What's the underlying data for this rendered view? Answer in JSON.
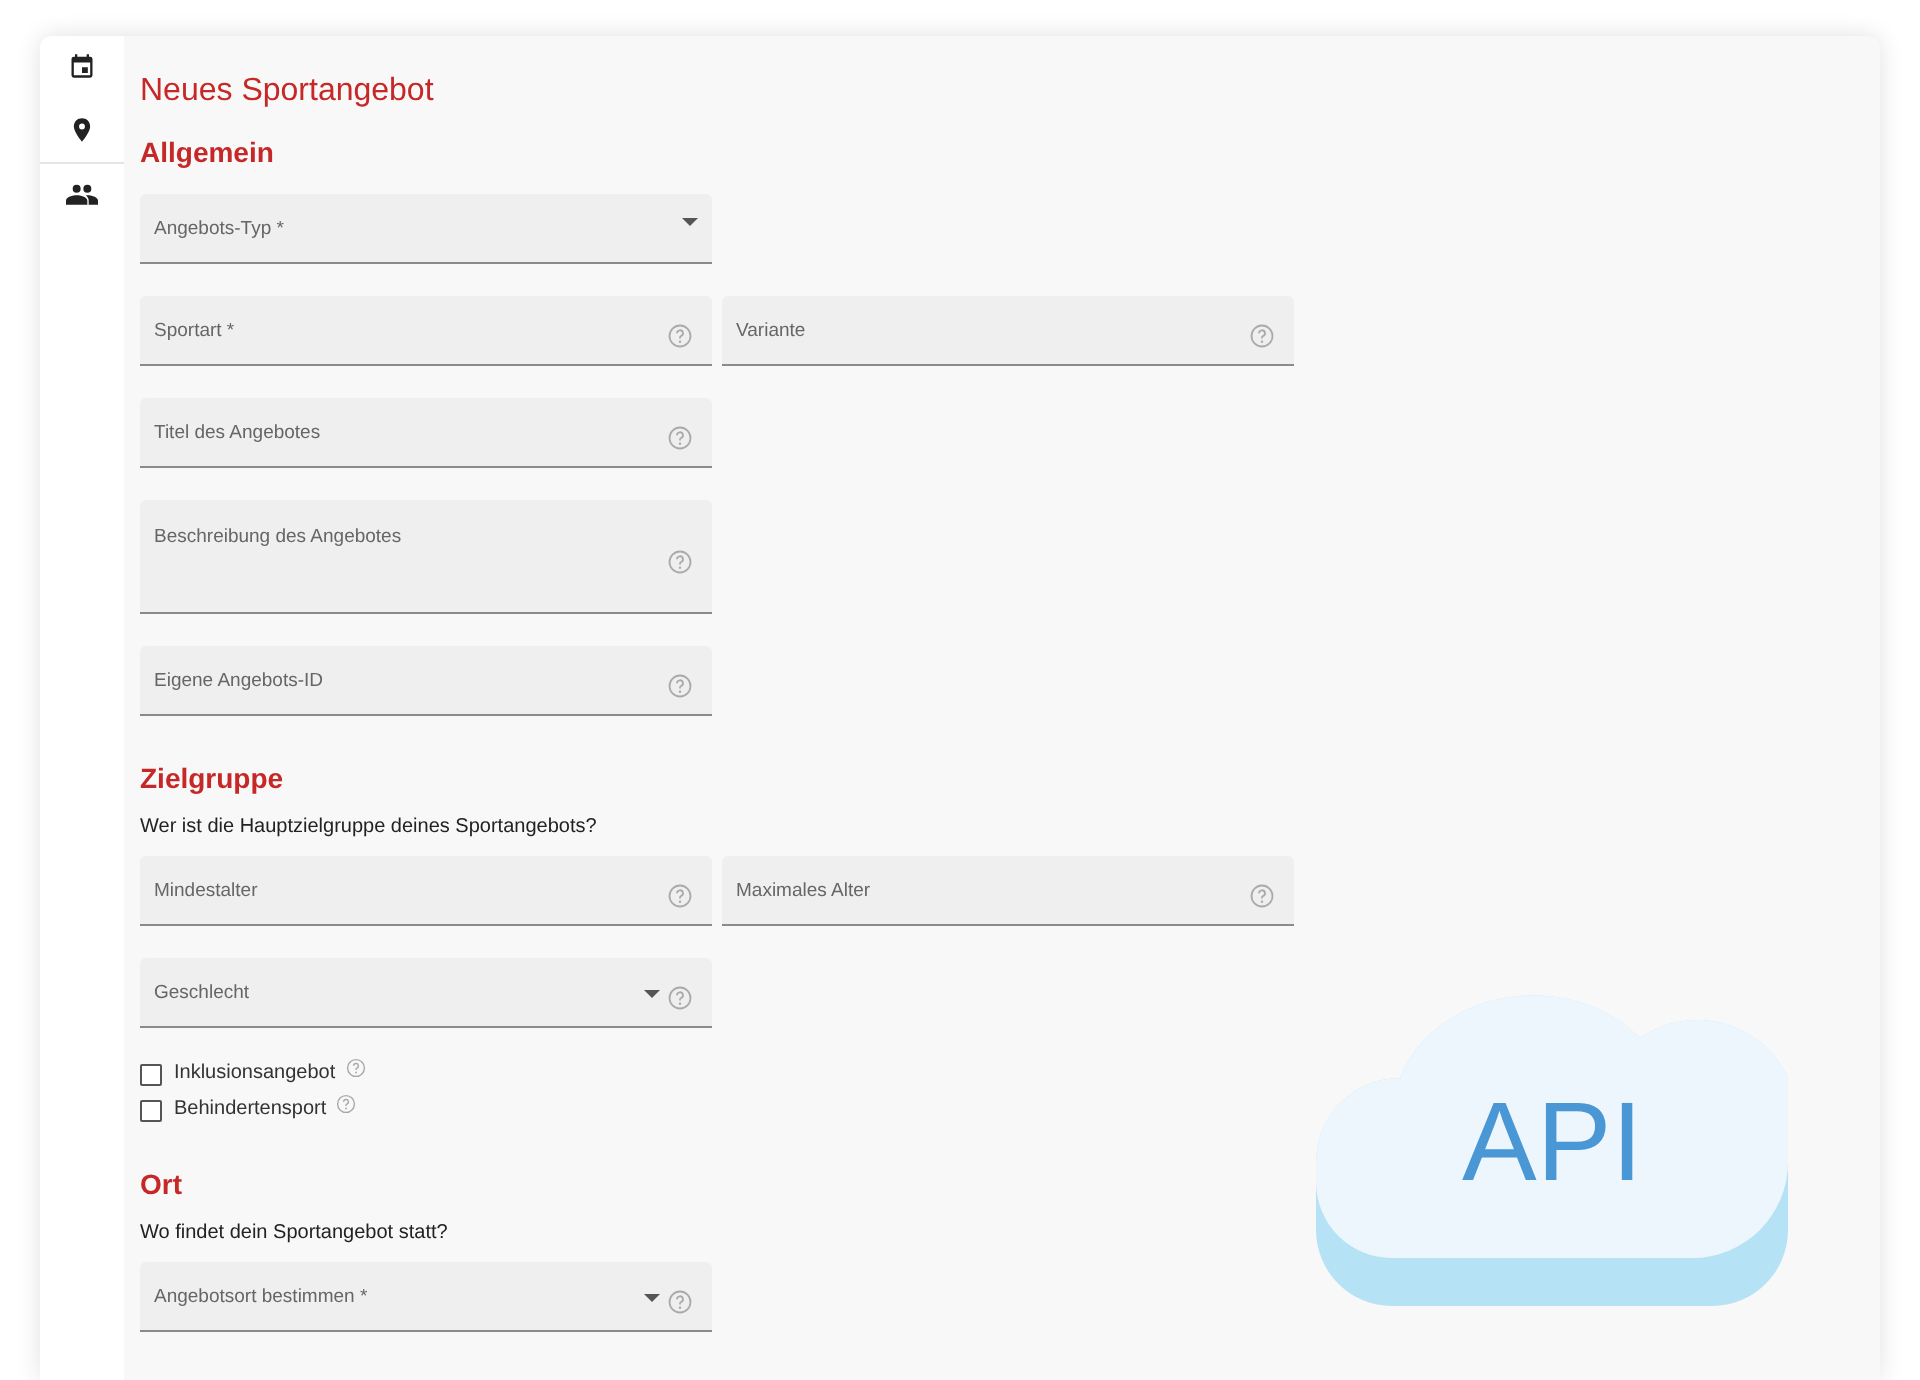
{
  "title": "Neues Sportangebot",
  "sections": [
    {
      "heading": "Allgemein",
      "rows": [
        [
          {
            "kind": "select",
            "label": "Angebots-Typ *",
            "help": false
          }
        ],
        [
          {
            "kind": "text",
            "label": "Sportart *",
            "help": true
          },
          {
            "kind": "text",
            "label": "Variante",
            "help": true
          }
        ],
        [
          {
            "kind": "text",
            "label": "Titel des Angebotes",
            "help": true
          }
        ],
        [
          {
            "kind": "textarea",
            "label": "Beschreibung des Angebotes",
            "help": true
          }
        ],
        [
          {
            "kind": "text",
            "label": "Eigene Angebots-ID",
            "help": true
          }
        ]
      ]
    },
    {
      "heading": "Zielgruppe",
      "prompt": "Wer ist die Hauptzielgruppe deines Sportangebots?",
      "rows": [
        [
          {
            "kind": "text",
            "label": "Mindestalter",
            "help": true
          },
          {
            "kind": "text",
            "label": "Maximales Alter",
            "help": true
          }
        ],
        [
          {
            "kind": "select",
            "label": "Geschlecht",
            "help": true
          }
        ]
      ],
      "checkboxes": [
        {
          "label": "Inklusionsangebot",
          "checked": false,
          "help": true
        },
        {
          "label": "Behindertensport",
          "checked": false,
          "help": true
        }
      ]
    },
    {
      "heading": "Ort",
      "prompt": "Wo findet dein Sportangebot statt?",
      "rows": [
        [
          {
            "kind": "select",
            "label": "Angebotsort bestimmen *",
            "help": true
          }
        ]
      ]
    }
  ],
  "badge": {
    "label": "API"
  }
}
